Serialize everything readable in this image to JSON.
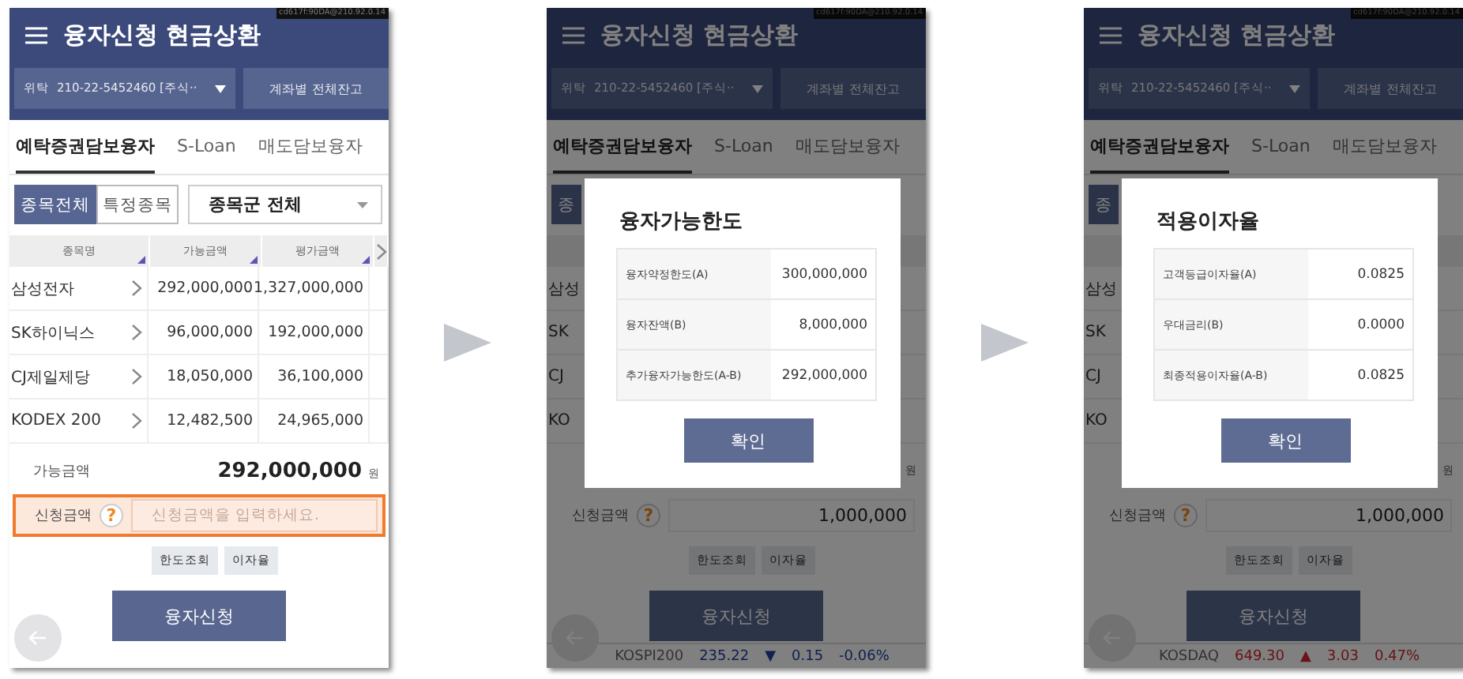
{
  "screens": [
    {
      "status_text": "cd617f:90DA@210.92.0.14",
      "title": "융자신청 현금상환",
      "account": {
        "type": "위탁",
        "number": "210-22-5452460 [주식··"
      },
      "balance_button": "계좌별 전체잔고",
      "tabs": [
        {
          "label": "예탁증권담보융자",
          "selected": true
        },
        {
          "label": "S-Loan",
          "selected": false
        },
        {
          "label": "매도담보융자",
          "selected": false
        }
      ],
      "filter": {
        "segments": [
          {
            "label": "종목전체",
            "selected": true
          },
          {
            "label": "특정종목",
            "selected": false
          }
        ],
        "dropdown": "종목군 전체"
      },
      "table": {
        "columns": [
          "종목명",
          "가능금액",
          "평가금액"
        ],
        "rows": [
          {
            "cells": [
              "삼성전자",
              "292,000,000",
              "1,327,000,000"
            ]
          },
          {
            "cells": [
              "SK하이닉스",
              "96,000,000",
              "192,000,000"
            ]
          },
          {
            "cells": [
              "CJ제일제당",
              "18,050,000",
              "36,100,000"
            ]
          },
          {
            "cells": [
              "KODEX 200",
              "12,482,500",
              "24,965,000"
            ]
          }
        ]
      },
      "available": {
        "label": "가능금액",
        "value": "292,000,000",
        "unit": "원"
      },
      "request": {
        "label": "신청금액",
        "help": "?",
        "placeholder": "신청금액을 입력하세요.",
        "highlighted": true
      },
      "small_buttons": [
        "한도조회",
        "이자율"
      ],
      "submit": "융자신청"
    },
    {
      "status_text": "cd617f:90DA@210.92.0.14",
      "title": "융자신청 현금상환",
      "account": {
        "type": "위탁",
        "number": "210-22-5452460 [주식··"
      },
      "balance_button": "계좌별 전체잔고",
      "tabs": [
        {
          "label": "예탁증권담보융자",
          "selected": true
        },
        {
          "label": "S-Loan",
          "selected": false
        },
        {
          "label": "매도담보융자",
          "selected": false
        }
      ],
      "filter": {
        "segments": [
          {
            "label": "종",
            "selected": true
          }
        ]
      },
      "table": {
        "rows": [
          {
            "cells": [
              "삼성"
            ]
          },
          {
            "cells": [
              "SK"
            ]
          },
          {
            "cells": [
              "CJ"
            ]
          },
          {
            "cells": [
              "KO"
            ]
          }
        ]
      },
      "available": {
        "unit": "원"
      },
      "request": {
        "label": "신청금액",
        "help": "?",
        "value": "1,000,000",
        "highlighted": false
      },
      "small_buttons": [
        "한도조회",
        "이자율"
      ],
      "submit": "융자신청",
      "ticker": {
        "name": "KOSPI200",
        "price": "235.22",
        "arrow": "▼",
        "change": "0.15",
        "rate": "-0.06%",
        "rising": false
      },
      "dialog": {
        "title": "융자가능한도",
        "rows": [
          {
            "label": "융자약정한도(A)",
            "value": "300,000,000"
          },
          {
            "label": "융자잔액(B)",
            "value": "8,000,000"
          },
          {
            "label": "추가융자가능한도(A-B)",
            "value": "292,000,000"
          }
        ],
        "button": "확인"
      }
    },
    {
      "status_text": "cd617f:90DA@210.92.0.14",
      "title": "융자신청 현금상환",
      "account": {
        "type": "위탁",
        "number": "210-22-5452460 [주식··"
      },
      "balance_button": "계좌별 전체잔고",
      "tabs": [
        {
          "label": "예탁증권담보융자",
          "selected": true
        },
        {
          "label": "S-Loan",
          "selected": false
        },
        {
          "label": "매도담보융자",
          "selected": false
        }
      ],
      "filter": {
        "segments": [
          {
            "label": "종",
            "selected": true
          }
        ]
      },
      "table": {
        "rows": [
          {
            "cells": [
              "삼성"
            ]
          },
          {
            "cells": [
              "SK"
            ]
          },
          {
            "cells": [
              "CJ"
            ]
          },
          {
            "cells": [
              "KO"
            ]
          }
        ]
      },
      "available": {
        "unit": "원"
      },
      "request": {
        "label": "신청금액",
        "help": "?",
        "value": "1,000,000",
        "highlighted": false
      },
      "small_buttons": [
        "한도조회",
        "이자율"
      ],
      "submit": "융자신청",
      "ticker": {
        "name": "KOSDAQ",
        "price": "649.30",
        "arrow": "▲",
        "change": "3.03",
        "rate": "0.47%",
        "rising": true
      },
      "dialog": {
        "title": "적용이자율",
        "rows": [
          {
            "label": "고객등급이자율(A)",
            "value": "0.0825"
          },
          {
            "label": "우대금리(B)",
            "value": "0.0000"
          },
          {
            "label": "최종적용이자율(A-B)",
            "value": "0.0825"
          }
        ],
        "button": "확인"
      }
    }
  ]
}
